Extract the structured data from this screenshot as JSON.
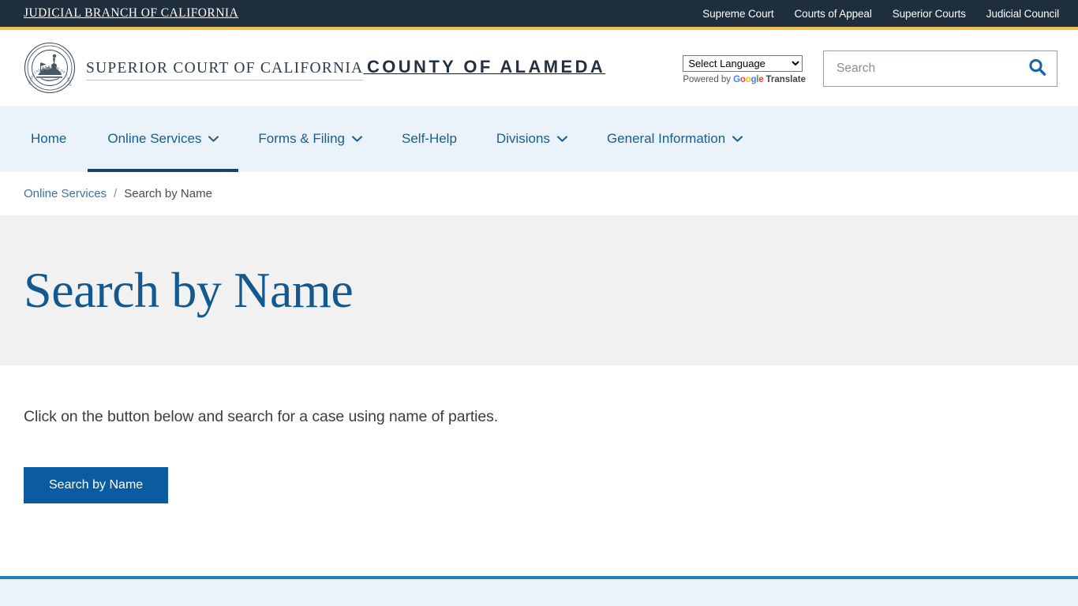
{
  "topbar": {
    "brand": "JUDICIAL BRANCH OF CALIFORNIA",
    "links": [
      {
        "label": "Supreme Court"
      },
      {
        "label": "Courts of Appeal"
      },
      {
        "label": "Superior Courts"
      },
      {
        "label": "Judicial Council"
      }
    ],
    "background": "#1f2e3d",
    "accent_rule": "#eec052"
  },
  "masthead": {
    "seal_alt": "judicial-branch-of-california-seal",
    "title_line1": "SUPERIOR COURT OF CALIFORNIA",
    "title_line2": "COUNTY OF ALAMEDA",
    "language": {
      "selected": "Select Language",
      "options": [
        "Select Language"
      ],
      "credit_prefix": "Powered by",
      "credit_google": "Google",
      "credit_suffix": "Translate"
    },
    "search": {
      "placeholder": "Search",
      "value": "",
      "icon": "search-icon"
    }
  },
  "mainnav": {
    "background": "#eaf2fa",
    "active_indicator_color": "#1b4468",
    "items": [
      {
        "label": "Home",
        "has_dropdown": false,
        "active": false
      },
      {
        "label": "Online Services",
        "has_dropdown": true,
        "active": true
      },
      {
        "label": "Forms & Filing",
        "has_dropdown": true,
        "active": false
      },
      {
        "label": "Self-Help",
        "has_dropdown": false,
        "active": false
      },
      {
        "label": "Divisions",
        "has_dropdown": true,
        "active": false
      },
      {
        "label": "General Information",
        "has_dropdown": true,
        "active": false
      }
    ]
  },
  "breadcrumb": {
    "parent": "Online Services",
    "separator": "/",
    "current": "Search by Name"
  },
  "hero": {
    "title": "Search by Name",
    "background": "#f1f1f1",
    "title_color": "#13588f"
  },
  "content": {
    "paragraph": "Click on the button below and search for a case using name of parties.",
    "cta_label": "Search by Name",
    "cta_color": "#0a5ba0"
  },
  "footer": {
    "rule_color": "#2b7cb9",
    "background": "#eaf2fa"
  }
}
